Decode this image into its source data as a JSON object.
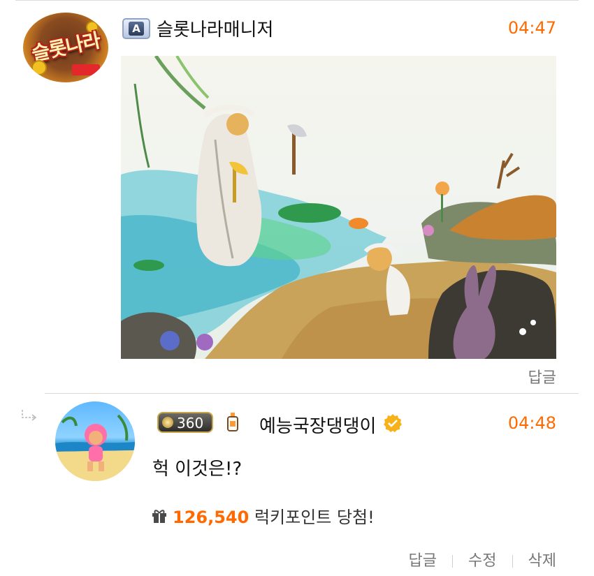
{
  "comment1": {
    "avatar_logo_text": "슬롯나라",
    "badge_label": "A",
    "username": "슬롯나라매니저",
    "time": "04:47",
    "reply_label": "답글",
    "image_alt": "illustration-woodcutter-and-mountain-god"
  },
  "comment2": {
    "level": "360",
    "username": "예능국장댕댕이",
    "time": "04:48",
    "text": "헉 이것은!?",
    "lucky": {
      "points": "126,540",
      "suffix": " 럭키포인트 당첨!"
    },
    "actions": {
      "reply": "답글",
      "edit": "수정",
      "delete": "삭제"
    }
  },
  "colors": {
    "accent": "#ff6a00",
    "muted": "#777777",
    "divider": "#d9d9d9"
  }
}
